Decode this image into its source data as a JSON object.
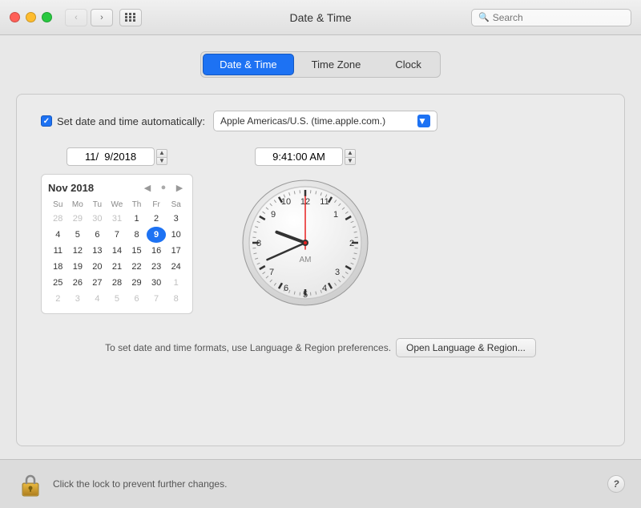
{
  "titlebar": {
    "title": "Date & Time",
    "search_placeholder": "Search"
  },
  "tabs": {
    "items": [
      {
        "label": "Date & Time",
        "active": true
      },
      {
        "label": "Time Zone",
        "active": false
      },
      {
        "label": "Clock",
        "active": false
      }
    ]
  },
  "auto_time": {
    "checkbox_label": "Set date and time automatically:",
    "server": "Apple Americas/U.S. (time.apple.com.)"
  },
  "date": {
    "value": "11/  9/2018",
    "display": "11/  9/2018"
  },
  "time": {
    "value": "9:41:00 AM"
  },
  "calendar": {
    "title": "Nov 2018",
    "weekdays": [
      "Su",
      "Mo",
      "Tu",
      "We",
      "Th",
      "Fr",
      "Sa"
    ],
    "weeks": [
      [
        "28",
        "29",
        "30",
        "31",
        "1",
        "2",
        "3"
      ],
      [
        "4",
        "5",
        "6",
        "7",
        "8",
        "9",
        "10"
      ],
      [
        "11",
        "12",
        "13",
        "14",
        "15",
        "16",
        "17"
      ],
      [
        "18",
        "19",
        "20",
        "21",
        "22",
        "23",
        "24"
      ],
      [
        "25",
        "26",
        "27",
        "28",
        "29",
        "30",
        "1"
      ],
      [
        "2",
        "3",
        "4",
        "5",
        "6",
        "7",
        "8"
      ]
    ],
    "today": "9",
    "other_month_starts": [
      "28",
      "29",
      "30",
      "31"
    ],
    "other_month_ends_row4": [],
    "other_month_ends_row5": [
      "1"
    ],
    "other_month_ends_row6": [
      "2",
      "3",
      "4",
      "5",
      "6",
      "7",
      "8"
    ]
  },
  "clock": {
    "hours": 9,
    "minutes": 41,
    "seconds": 0,
    "am_pm": "AM"
  },
  "bottom": {
    "text": "To set date and time formats, use Language & Region preferences.",
    "button_label": "Open Language & Region..."
  },
  "footer": {
    "lock_text": "Click the lock to prevent further changes.",
    "help_label": "?"
  },
  "icons": {
    "back": "‹",
    "forward": "›",
    "chevron_up": "▲",
    "chevron_down": "▼",
    "cal_prev": "◀",
    "cal_next": "▶",
    "search": "🔍",
    "dropdown_arrow": "▼"
  }
}
